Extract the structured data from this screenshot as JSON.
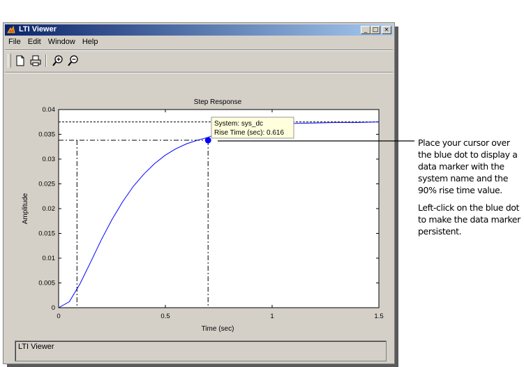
{
  "window": {
    "title": "LTI Viewer",
    "min_label": "_",
    "max_label": "□",
    "close_label": "×"
  },
  "menu": [
    {
      "label": "File"
    },
    {
      "label": "Edit"
    },
    {
      "label": "Window"
    },
    {
      "label": "Help"
    }
  ],
  "toolbar": {
    "icons": [
      "new-icon",
      "print-icon",
      "zoom-in-icon",
      "zoom-out-icon"
    ]
  },
  "plot": {
    "title": "Step Response",
    "xlabel": "Time (sec)",
    "ylabel": "Amplitude",
    "xticks": [
      "0",
      "0.5",
      "1",
      "1.5"
    ],
    "yticks": [
      "0",
      "0.005",
      "0.01",
      "0.015",
      "0.02",
      "0.025",
      "0.03",
      "0.035",
      "0.04"
    ],
    "line_color": "#0000ff"
  },
  "datatip": {
    "line1": "System: sys_dc",
    "line2": "Rise Time (sec): 0.616"
  },
  "status_text": "LTI Viewer",
  "annotation": {
    "para1": "Place your cursor over the blue dot to display a data marker with the system name and the 90% rise time value.",
    "para2": "Left-click on the blue dot to make the data marker persistent."
  },
  "chart_data": {
    "type": "line",
    "title": "Step Response",
    "xlabel": "Time (sec)",
    "ylabel": "Amplitude",
    "xlim": [
      0,
      1.5
    ],
    "ylim": [
      0,
      0.04
    ],
    "series": [
      {
        "name": "sys_dc",
        "x": [
          0,
          0.05,
          0.1,
          0.15,
          0.2,
          0.25,
          0.3,
          0.35,
          0.4,
          0.45,
          0.5,
          0.55,
          0.6,
          0.65,
          0.7,
          0.75,
          0.8,
          0.9,
          1.0,
          1.1,
          1.2,
          1.3,
          1.4,
          1.5
        ],
        "y": [
          0,
          0.0012,
          0.0048,
          0.0092,
          0.0137,
          0.0178,
          0.0214,
          0.0245,
          0.027,
          0.0291,
          0.0308,
          0.0321,
          0.0331,
          0.0338,
          0.0344,
          0.0353,
          0.0359,
          0.0366,
          0.037,
          0.0372,
          0.0373,
          0.0374,
          0.0374,
          0.0375
        ]
      }
    ],
    "steady_state": 0.0375,
    "rise_time_start": 0.086,
    "rise_time_end": 0.7,
    "rise_value": 0.0338
  }
}
